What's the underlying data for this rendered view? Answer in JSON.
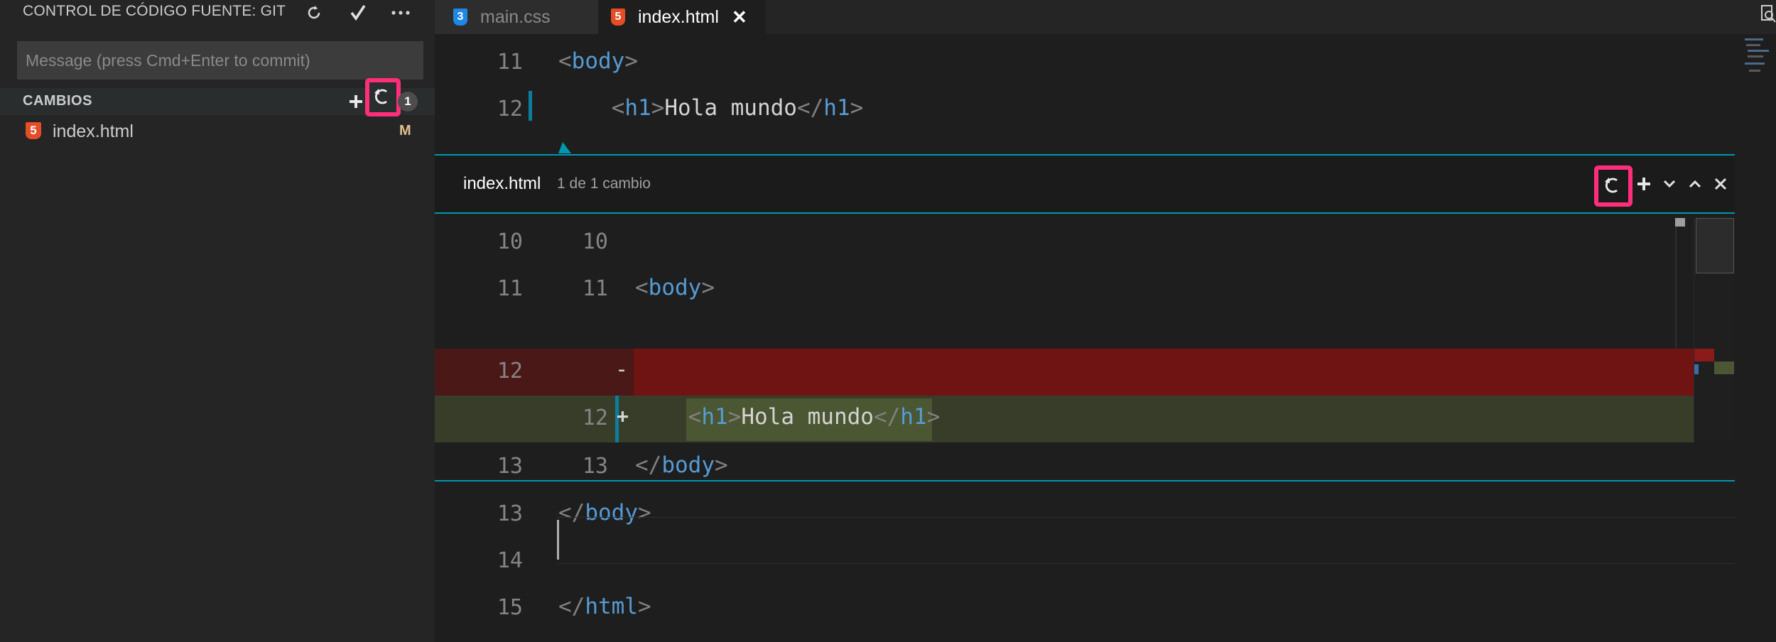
{
  "sidebar": {
    "title": "CONTROL DE CÓDIGO FUENTE: GIT",
    "actions": [
      "refresh-icon",
      "check-icon",
      "more-icon"
    ],
    "commit_placeholder": "Message (press Cmd+Enter to commit)",
    "changes": {
      "label": "CAMBIOS",
      "count": "1",
      "files": [
        {
          "name": "index.html",
          "status": "M",
          "icon": "html5-icon"
        }
      ]
    }
  },
  "tabs": [
    {
      "label": "main.css",
      "icon": "css3-icon",
      "active": false
    },
    {
      "label": "index.html",
      "icon": "html5-icon",
      "active": true
    }
  ],
  "editor": {
    "top_lines": [
      {
        "n": "11",
        "open": "<",
        "tag": "body",
        "close": ">"
      },
      {
        "n": "12",
        "indent": "    ",
        "open": "<",
        "tag": "h1",
        "close": ">",
        "text": "Hola mundo",
        "open2": "</",
        "tag2": "h1",
        "close2": ">"
      }
    ],
    "bottom_lines": [
      {
        "n": "13",
        "open": "</",
        "tag": "body",
        "close": ">"
      },
      {
        "n": "14"
      },
      {
        "n": "15",
        "open": "</",
        "tag": "html",
        "close": ">"
      }
    ]
  },
  "peek": {
    "title": "index.html",
    "subtitle": "1 de 1 cambio",
    "actions": [
      "revert-icon",
      "stage-icon",
      "chevron-down-icon",
      "chevron-up-icon",
      "close-icon"
    ],
    "diff_lines": [
      {
        "orig": "10",
        "mod": "10",
        "marker": "",
        "content": ""
      },
      {
        "orig": "11",
        "mod": "11",
        "marker": "",
        "open": "<",
        "tag": "body",
        "close": ">"
      },
      {
        "orig": "12",
        "mod": "",
        "marker": "-",
        "content": ""
      },
      {
        "orig": "",
        "mod": "12",
        "marker": "+",
        "indent": "    ",
        "open": "<",
        "tag": "h1",
        "close": ">",
        "text": "Hola mundo",
        "open2": "</",
        "tag2": "h1",
        "close2": ">"
      },
      {
        "orig": "13",
        "mod": "13",
        "marker": "",
        "open": "</",
        "tag": "body",
        "close": ">"
      }
    ]
  },
  "colors": {
    "highlight": "#ff2e7a",
    "deleted_line": "#6f1313",
    "added_line": "#373d29",
    "accent": "#0097b2"
  }
}
